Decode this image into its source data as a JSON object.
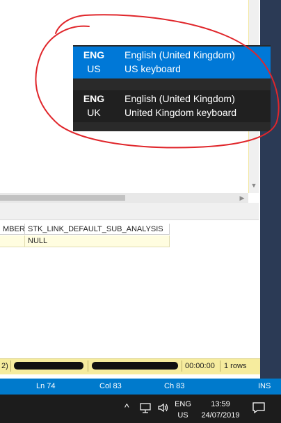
{
  "language_flyout": {
    "items": [
      {
        "code": "ENG",
        "layout_code": "US",
        "language": "English (United Kingdom)",
        "keyboard": "US keyboard",
        "selected": true
      },
      {
        "code": "ENG",
        "layout_code": "UK",
        "language": "English (United Kingdom)",
        "keyboard": "United Kingdom keyboard",
        "selected": false
      }
    ]
  },
  "results_grid": {
    "columns": [
      "MBER",
      "STK_LINK_DEFAULT_SUB_ANALYSIS"
    ],
    "rows": [
      [
        "",
        "NULL"
      ]
    ]
  },
  "query_status": {
    "item1": "2)",
    "elapsed": "00:00:00",
    "rows": "1 rows"
  },
  "status_bar": {
    "line": "Ln 74",
    "col": "Col 83",
    "ch": "Ch 83",
    "mode": "INS"
  },
  "taskbar": {
    "lang_code": "ENG",
    "lang_layout": "US",
    "time": "13:59",
    "date": "24/07/2019"
  },
  "colors": {
    "accent_blue": "#0078d7",
    "status_bar_blue": "#007acc",
    "annotation_red": "#e0262b",
    "query_status_yellow": "#f6ec9e"
  }
}
